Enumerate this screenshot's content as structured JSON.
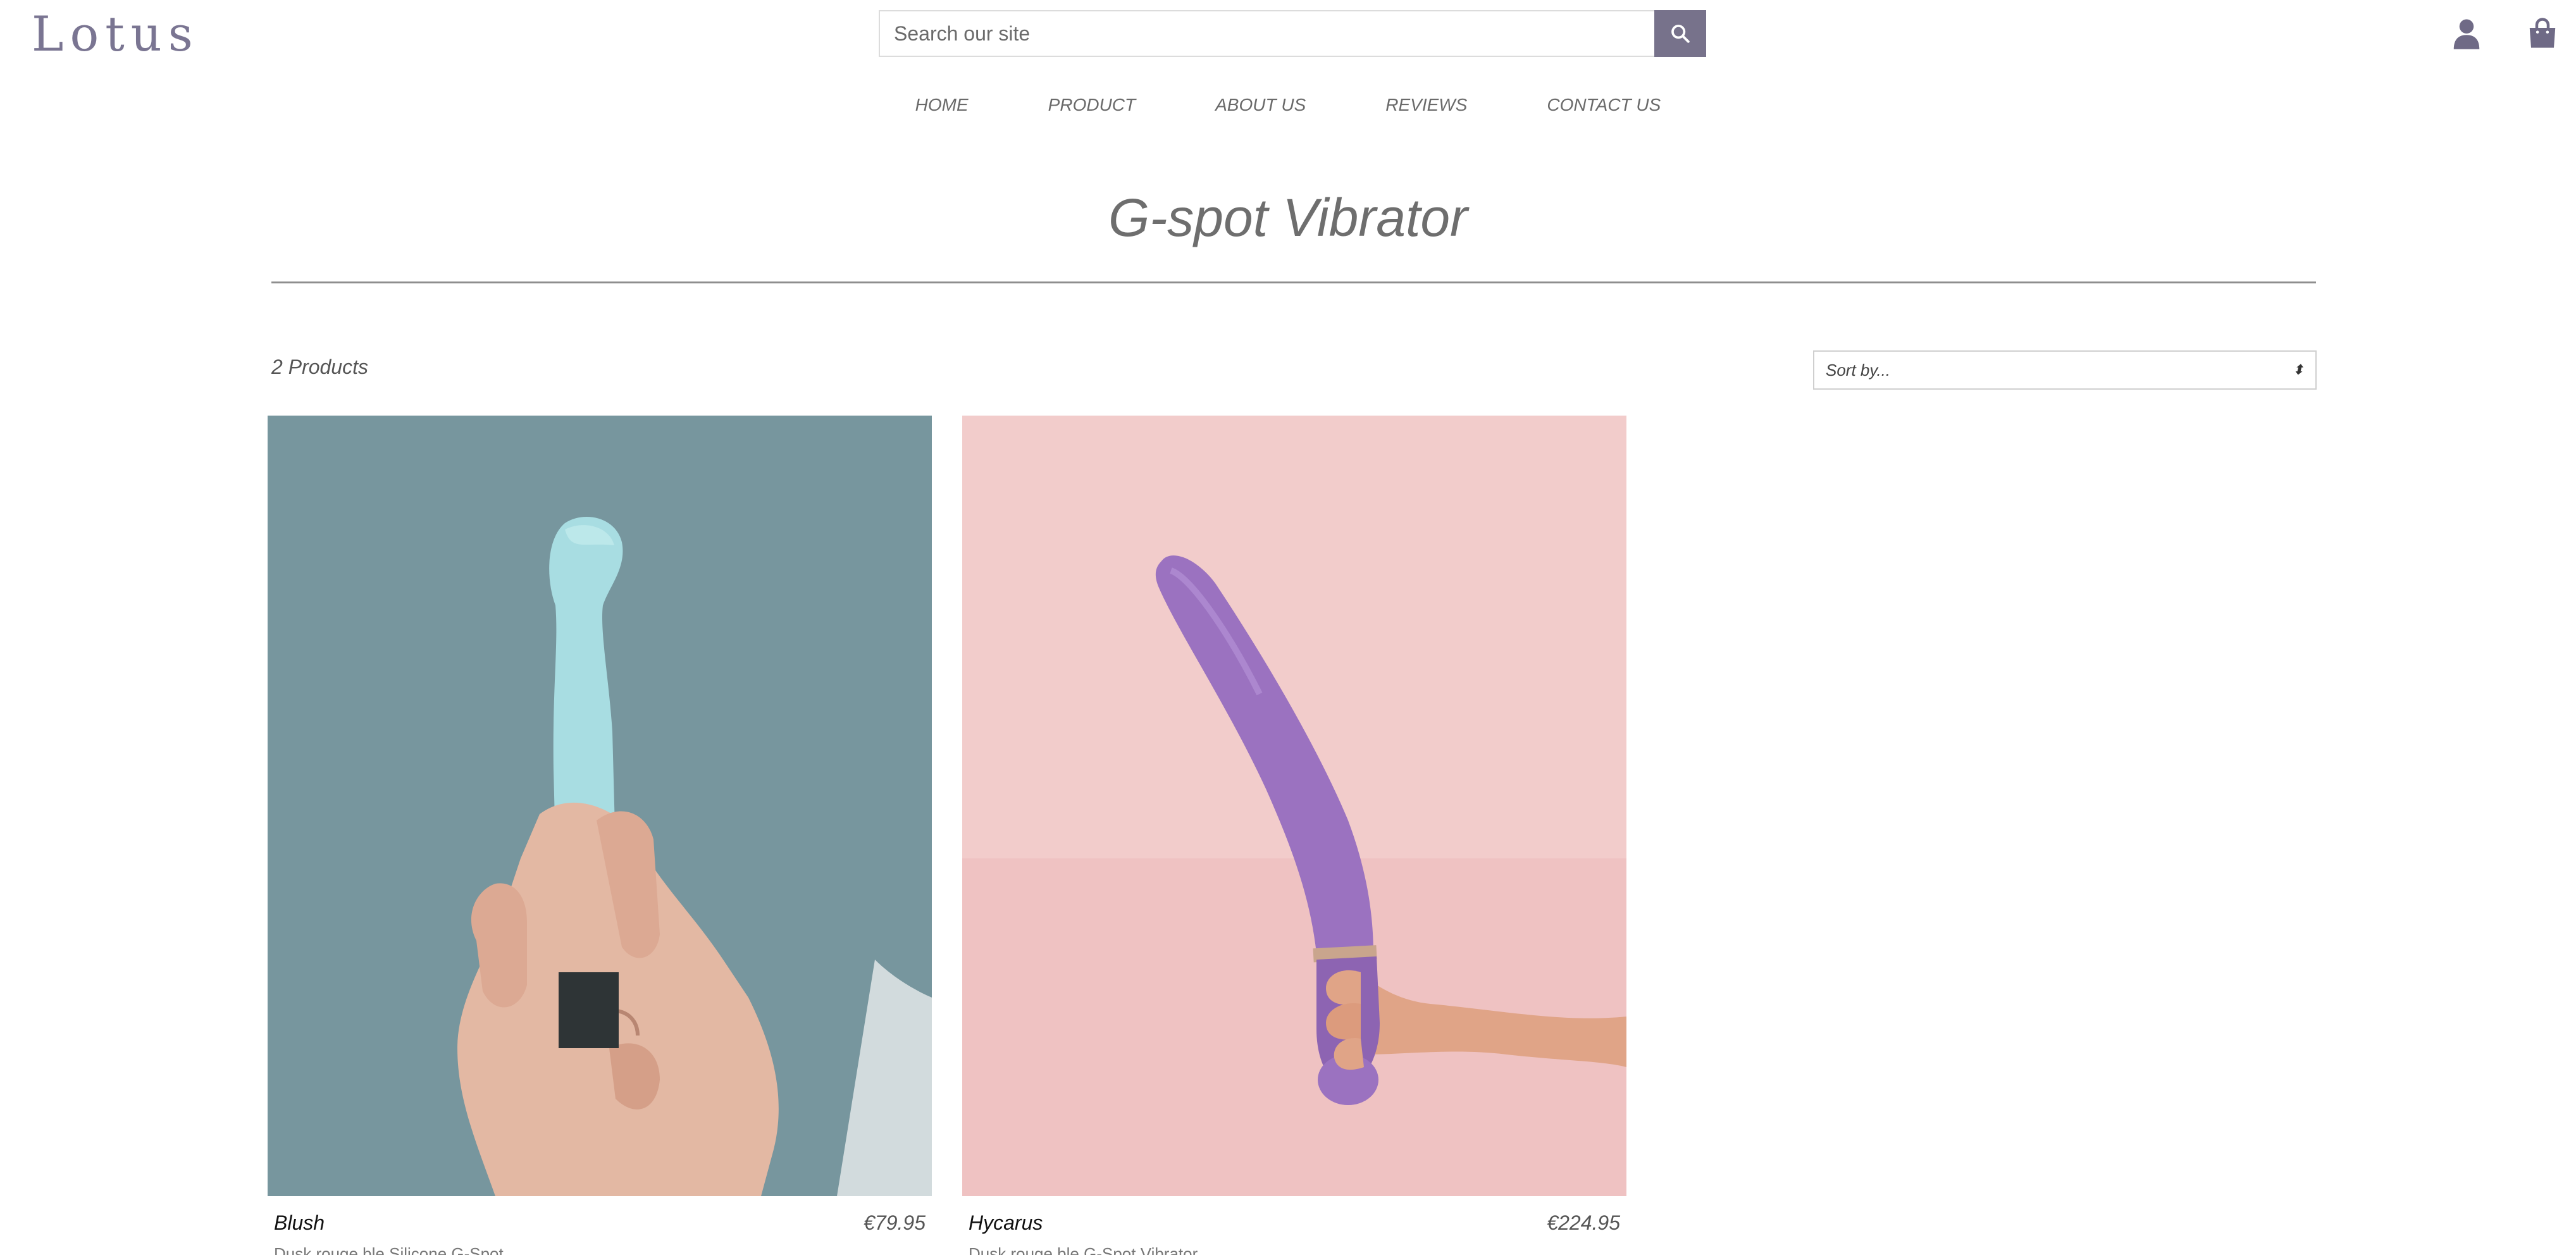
{
  "brand": {
    "logo_text": "Lotus",
    "accent_color": "#77728b"
  },
  "search": {
    "placeholder": "Search our site",
    "button_icon": "search-icon"
  },
  "header_icons": {
    "account": "user-icon",
    "cart": "shopping-bag-icon"
  },
  "nav": {
    "items": [
      {
        "label": "HOME"
      },
      {
        "label": "PRODUCT"
      },
      {
        "label": "ABOUT US"
      },
      {
        "label": "REVIEWS"
      },
      {
        "label": "CONTACT US"
      }
    ]
  },
  "collection": {
    "title": "G-spot Vibrator",
    "product_count": "2 Products",
    "sort_label": "Sort by..."
  },
  "products": [
    {
      "name": "Blush",
      "price": "€79.95",
      "subtitle": "Dusk rouge ble Silicone G-Spot",
      "image_background": "#7c9aa1",
      "toy_color": "#a8dde2"
    },
    {
      "name": "Hycarus",
      "price": "€224.95",
      "subtitle": "Dusk rouge ble G-Spot Vibrator",
      "image_background": "#f2cccb",
      "toy_color": "#9b72c0"
    }
  ]
}
